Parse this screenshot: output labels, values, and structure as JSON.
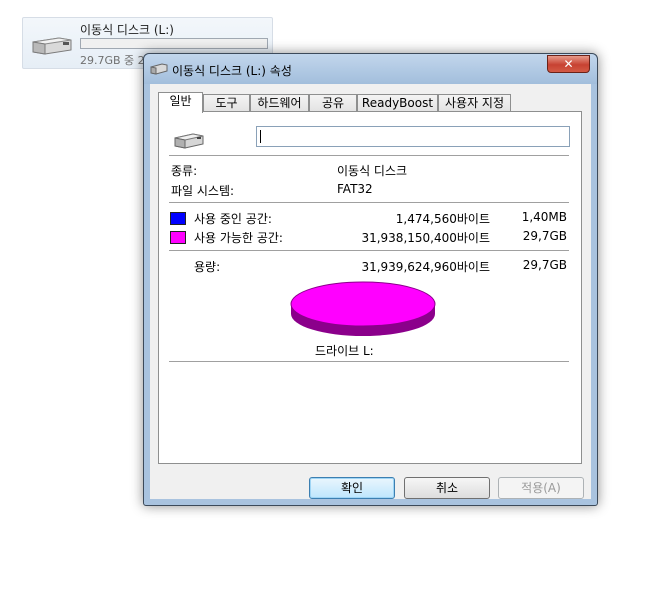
{
  "explorer": {
    "drive_name": "이동식 디스크 (L:)",
    "drive_subtext": "29.7GB 중 2",
    "usage_fraction": 0.0
  },
  "dialog": {
    "title": "이동식 디스크 (L:) 속성",
    "close_glyph": "✕",
    "tabs": [
      {
        "label": "일반",
        "active": true
      },
      {
        "label": "도구"
      },
      {
        "label": "하드웨어"
      },
      {
        "label": "공유"
      },
      {
        "label": "ReadyBoost"
      },
      {
        "label": "사용자 지정"
      }
    ],
    "general": {
      "name_value": "",
      "type_label": "종류:",
      "type_value": "이동식 디스크",
      "fs_label": "파일 시스템:",
      "fs_value": "FAT32",
      "used": {
        "label": "사용 중인 공간:",
        "bytes": "1,474,560바이트",
        "size": "1,40MB",
        "color": "#0000ff"
      },
      "free": {
        "label": "사용 가능한 공간:",
        "bytes": "31,938,150,400바이트",
        "size": "29,7GB",
        "color": "#ff00ff"
      },
      "capacity": {
        "label": "용량:",
        "bytes": "31,939,624,960바이트",
        "size": "29,7GB"
      },
      "drive_label": "드라이브 L:"
    },
    "buttons": {
      "ok": "확인",
      "cancel": "취소",
      "apply": "적용(A)"
    }
  }
}
